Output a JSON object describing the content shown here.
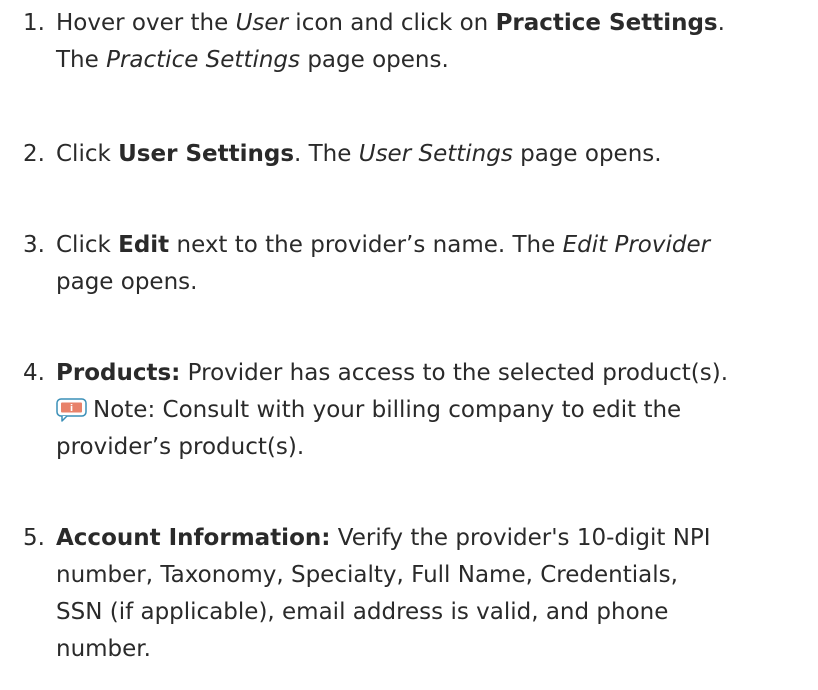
{
  "steps": [
    {
      "number": "1.",
      "parts": [
        {
          "text": "Hover over the ",
          "style": "normal"
        },
        {
          "text": "User",
          "style": "italic"
        },
        {
          "text": " icon and click on ",
          "style": "normal"
        },
        {
          "text": "Practice Settings",
          "style": "bold"
        },
        {
          "text": ".",
          "style": "normal"
        },
        {
          "text": "The ",
          "style": "normal"
        },
        {
          "text": "Practice Settings",
          "style": "italic"
        },
        {
          "text": " page opens.",
          "style": "normal"
        }
      ]
    },
    {
      "number": "2.",
      "parts": [
        {
          "text": "Click ",
          "style": "normal"
        },
        {
          "text": "User Settings",
          "style": "bold"
        },
        {
          "text": ". The ",
          "style": "normal"
        },
        {
          "text": "User Settings",
          "style": "italic"
        },
        {
          "text": " page opens.",
          "style": "normal"
        }
      ]
    },
    {
      "number": "3.",
      "parts": [
        {
          "text": "Click ",
          "style": "normal"
        },
        {
          "text": "Edit",
          "style": "bold"
        },
        {
          "text": " next to the provider’s name. The ",
          "style": "normal"
        },
        {
          "text": "Edit Provider",
          "style": "italic"
        },
        {
          "text": "page opens.",
          "style": "normal"
        }
      ]
    },
    {
      "number": "4.",
      "parts": [
        {
          "text": "Products:",
          "style": "bold"
        },
        {
          "text": " Provider has access to the selected product(s).",
          "style": "normal"
        },
        {
          "text": "Note: Consult with your billing company to edit the",
          "style": "normal"
        },
        {
          "text": "provider’s product(s).",
          "style": "normal"
        }
      ],
      "note_icon": {
        "name": "info-note-icon",
        "glyph": "i",
        "fill_color": "#e8826a",
        "border_color": "#3a8fb7"
      }
    },
    {
      "number": "5.",
      "parts": [
        {
          "text": "Account Information:",
          "style": "bold"
        },
        {
          "text": " Verify the provider's 10-digit NPI",
          "style": "normal"
        },
        {
          "text": "number, Taxonomy, Specialty, Full Name, Credentials,",
          "style": "normal"
        },
        {
          "text": "SSN (if applicable), email address is valid, and phone",
          "style": "normal"
        },
        {
          "text": "number.",
          "style": "normal"
        }
      ]
    }
  ],
  "colors": {
    "text": "#2a2a2a",
    "background": "#ffffff"
  }
}
